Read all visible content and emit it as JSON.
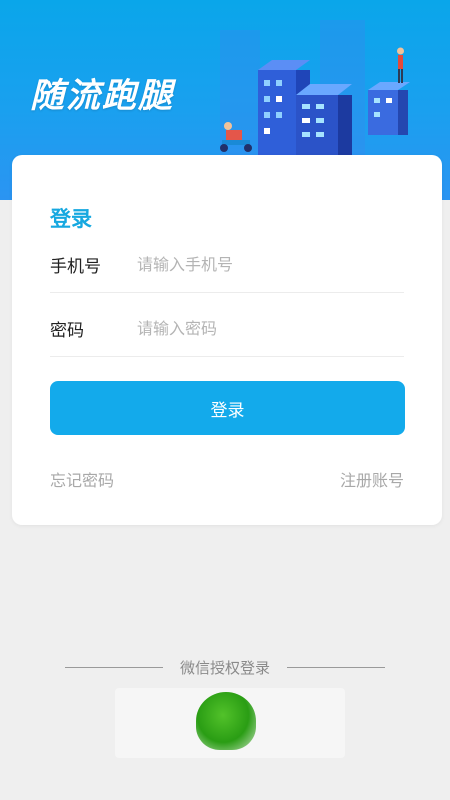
{
  "header": {
    "app_title": "随流跑腿"
  },
  "login_card": {
    "title": "登录",
    "phone": {
      "label": "手机号",
      "placeholder": "请输入手机号",
      "value": ""
    },
    "password": {
      "label": "密码",
      "placeholder": "请输入密码",
      "value": ""
    },
    "submit_label": "登录",
    "forgot_password": "忘记密码",
    "register": "注册账号"
  },
  "wechat": {
    "divider_text": "微信授权登录",
    "icon": "wechat-icon"
  },
  "colors": {
    "brand": "#13aaeb",
    "title": "#16a8e0",
    "banner": "#1aa0ef",
    "wechat": "#3aaa1e"
  }
}
